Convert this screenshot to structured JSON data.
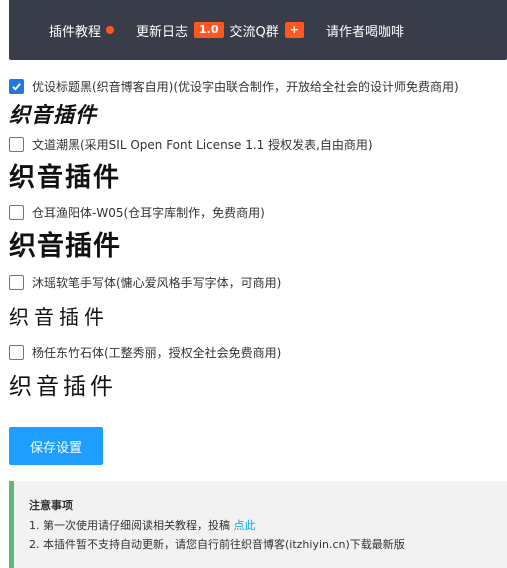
{
  "nav": {
    "tutorial": "插件教程",
    "changelog": "更新日志",
    "version_badge": "1.0",
    "qq_group": "交流Q群",
    "qq_badge": "+",
    "coffee": "请作者喝咖啡"
  },
  "fonts": [
    {
      "label": "优设标题黑(织音博客自用)(优设字由联合制作，开放给全社会的设计师免费商用)",
      "checked": true,
      "sample": "织音插件"
    },
    {
      "label": "文道潮黑(采用SIL Open Font License 1.1 授权发表,自由商用)",
      "checked": false,
      "sample": "织音插件"
    },
    {
      "label": "仓耳渔阳体-W05(仓耳字库制作，免费商用)",
      "checked": false,
      "sample": "织音插件"
    },
    {
      "label": "沐瑶软笔手写体(慵心爱风格手写字体，可商用)",
      "checked": false,
      "sample": "织音插件"
    },
    {
      "label": "杨任东竹石体(工整秀丽，授权全社会免费商用)",
      "checked": false,
      "sample": "织音插件"
    }
  ],
  "save_label": "保存设置",
  "notice": {
    "title": "注意事项",
    "line1_prefix": "1. 第一次使用请仔细阅读相关教程，投稿 ",
    "line1_link": "点此",
    "line2": "2. 本插件暂不支持自动更新，请您自行前往织音博客(itzhiyin.cn)下载最新版"
  },
  "colors": {
    "topbar": "#393d49",
    "accent": "#ff5722",
    "button": "#1e9fff",
    "notice_border": "#5fb878",
    "link": "#01aaed"
  }
}
